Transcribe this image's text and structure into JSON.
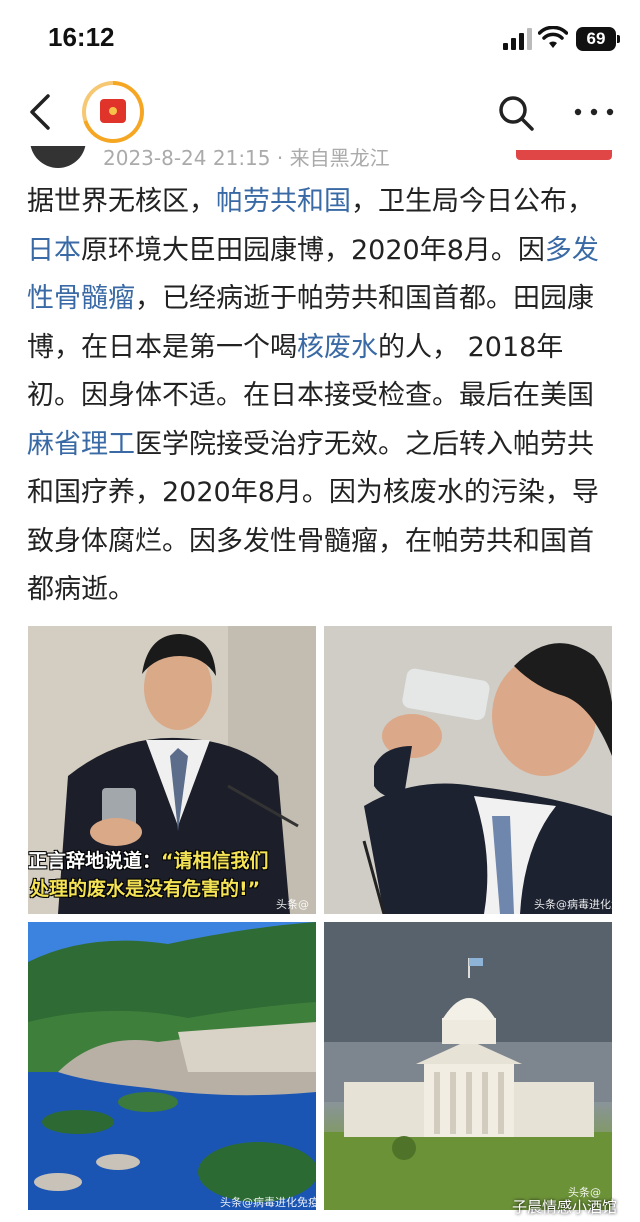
{
  "status_bar": {
    "time": "16:12",
    "battery": "69"
  },
  "meta": {
    "date_source": "2023-8-24 21:15 · 来自黑龙江"
  },
  "article": {
    "l1a": "据世界无核区，",
    "l1b": "帕劳共和国",
    "l1c": "，卫生局今日公布，",
    "l1d": "日本",
    "l1e": "原环境大臣田园康博，2020年8月。因",
    "l1f": "多发性骨髓瘤",
    "l1g": "，已经病逝于帕劳共和国首都。田园康博，在日本是第一个喝",
    "l1h": "核废水",
    "l1i": "的人， 2018年初。因身体不适。在日本接受检查。最后在美国",
    "l1j": "麻省理工",
    "l1k": "医学院接受治疗无效。之后转入帕劳共和国疗养，2020年8月。因为核废水的污染，导致身体腐烂。因多发性骨髓瘤，在帕劳共和国首都病逝。"
  },
  "photos": {
    "p1_caption_a": "正言辞地说道：",
    "p1_caption_b": "“请相信我们",
    "p1_caption_c": "处理的废水是没有危害的!”",
    "p1_watermark": "头条@",
    "p2_watermark": "头条@病毒进化免",
    "p3_watermark": "头条@病毒进化免疫学家",
    "p4_watermark": "头条@"
  },
  "corner_watermark": "子晨情感小酒馆",
  "icons": [
    "back-arrow-icon",
    "search-icon",
    "more-icon",
    "signal-icon",
    "wifi-icon",
    "battery-icon"
  ]
}
